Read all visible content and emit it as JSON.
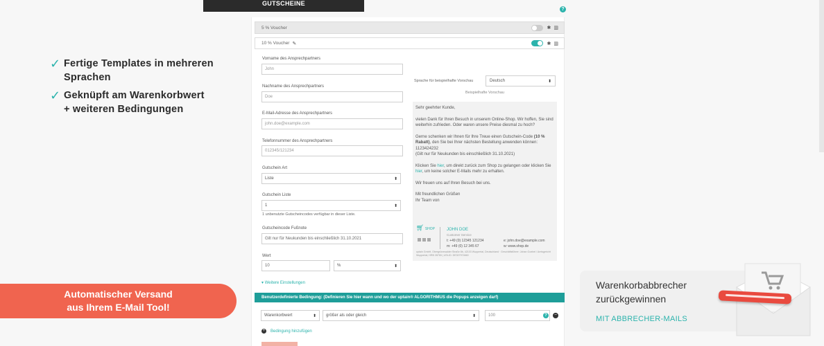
{
  "features": [
    {
      "line1": "Fertige Templates in mehreren",
      "line2": "Sprachen"
    },
    {
      "line1": "Geknüpft am Warenkorbwert",
      "line2": "+ weiteren Bedingungen"
    }
  ],
  "banner": {
    "line1": "Automatischer Versand",
    "line2": "aus Ihrem E-Mail Tool!"
  },
  "top_tab": "GUTSCHEINE",
  "vouchers": [
    {
      "label": "5 % Voucher",
      "enabled": false
    },
    {
      "label": "10 % Voucher",
      "enabled": true
    }
  ],
  "form": {
    "first_name": {
      "label": "Vorname des Ansprechpartners",
      "placeholder": "John"
    },
    "last_name": {
      "label": "Nachname des Ansprechpartners",
      "placeholder": "Doe"
    },
    "email": {
      "label": "E-Mail-Adresse des Ansprechpartners",
      "placeholder": "john.doe@example.com"
    },
    "phone": {
      "label": "Telefonnummer des Ansprechpartners",
      "placeholder": "012345/121234"
    },
    "voucher_type": {
      "label": "Gutschein Art",
      "value": "Liste"
    },
    "voucher_list": {
      "label": "Gutschein Liste",
      "value": "1",
      "note": "1 unbenutzte Gutscheincodes verfügbar in dieser Liste."
    },
    "footnote": {
      "label": "Gutscheincode Fußnote",
      "value": "Gilt nur für Neukunden bis einschließlich 31.10.2021"
    },
    "value": {
      "label": "Wert",
      "amount": "10",
      "unit": "%"
    },
    "more_settings": "Weitere Einstellungen"
  },
  "condition": {
    "header": "Benutzerdefinierte Bedingung: (Definieren Sie hier wann und wo der uptain® ALGORITHMUS die Popups anzeigen darf)",
    "field": "Warenkorbwert",
    "operator": "größer als oder gleich",
    "value": "100",
    "add_label": "Bedingung hinzufügen"
  },
  "preview": {
    "lang_label": "Sprache für beispielhafte Vorschau",
    "lang_value": "Deutsch",
    "caption": "Beispielhafte Vorschau",
    "greeting": "Sehr geehrter Kunde,",
    "p1": "vielen Dank für Ihren Besuch in unserem Online-Shop. Wir hoffen, Sie sind weiterhin zufrieden. Oder waren unsere Preise diesmal zu hoch?",
    "p2a": "Gerne schenken wir Ihnen für Ihre Treue einen Gutschein-Code ",
    "p2b": "(10 % Rabatt)",
    "p2c": ", den Sie bei Ihrer nächsten Bestellung anwenden können: 1123424232",
    "p2d": "(Gilt nur für Neukunden bis einschließlich 31.10.2021)",
    "p3a": "Klicken Sie ",
    "p3link1": "hier",
    "p3b": ", um direkt zurück zum Shop zu gelangen oder klicken Sie ",
    "p3link2": "hier",
    "p3c": ", um keine solcher E-Mails mehr zu erhalten.",
    "p4": "Wir freuen uns auf Ihren Besuch bei uns.",
    "closing1": "Mit freundlichen Grüßen",
    "closing2": "Ihr Team von",
    "sig_shop": "SHOP",
    "sig_name": "JOHN DOE",
    "sig_role": "Customer Service",
    "sig_phone": "t:  +49 (0) 12345 121234",
    "sig_fax": "m: +49 (0) 12 345 67",
    "sig_email": "e:  john.doe@example.com",
    "sig_web": "w: www.shop.de",
    "sig_footer": "uptain GmbH, Obergrünewalder Straße 8b, 42103 Wuppertal, Deutschland · Geschäftsführer: Johan Goebel / Amtsgericht Wuppertal, HRB 28765 | USt-ID: DE307974660"
  },
  "right_card": {
    "title_line1": "Warenkorbabbrecher",
    "title_line2": "zurückgewinnen",
    "link": "MIT ABBRECHER-MAILS"
  },
  "colors": {
    "teal": "#2bb3ac",
    "red": "#f0644f",
    "dark": "#2b2b2b"
  }
}
